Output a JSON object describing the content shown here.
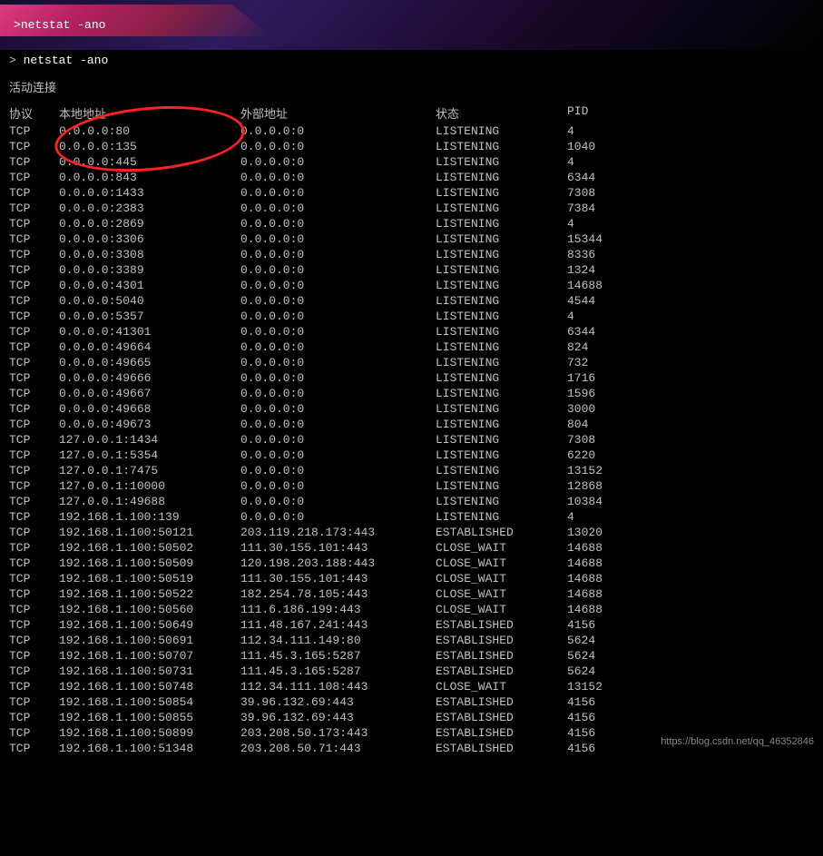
{
  "topbar": {
    "text": "netstat -ano"
  },
  "section_title": "活动连接",
  "headers": {
    "proto": "协议",
    "local": "本地地址",
    "foreign": "外部地址",
    "state": "状态",
    "pid": "PID"
  },
  "rows": [
    {
      "proto": "TCP",
      "local": "0.0.0.0:80",
      "foreign": "0.0.0.0:0",
      "state": "LISTENING",
      "pid": "4"
    },
    {
      "proto": "TCP",
      "local": "0.0.0.0:135",
      "foreign": "0.0.0.0:0",
      "state": "LISTENING",
      "pid": "1040"
    },
    {
      "proto": "TCP",
      "local": "0.0.0.0:445",
      "foreign": "0.0.0.0:0",
      "state": "LISTENING",
      "pid": "4"
    },
    {
      "proto": "TCP",
      "local": "0.0.0.0:843",
      "foreign": "0.0.0.0:0",
      "state": "LISTENING",
      "pid": "6344"
    },
    {
      "proto": "TCP",
      "local": "0.0.0.0:1433",
      "foreign": "0.0.0.0:0",
      "state": "LISTENING",
      "pid": "7308"
    },
    {
      "proto": "TCP",
      "local": "0.0.0.0:2383",
      "foreign": "0.0.0.0:0",
      "state": "LISTENING",
      "pid": "7384"
    },
    {
      "proto": "TCP",
      "local": "0.0.0.0:2869",
      "foreign": "0.0.0.0:0",
      "state": "LISTENING",
      "pid": "4"
    },
    {
      "proto": "TCP",
      "local": "0.0.0.0:3306",
      "foreign": "0.0.0.0:0",
      "state": "LISTENING",
      "pid": "15344"
    },
    {
      "proto": "TCP",
      "local": "0.0.0.0:3308",
      "foreign": "0.0.0.0:0",
      "state": "LISTENING",
      "pid": "8336"
    },
    {
      "proto": "TCP",
      "local": "0.0.0.0:3389",
      "foreign": "0.0.0.0:0",
      "state": "LISTENING",
      "pid": "1324"
    },
    {
      "proto": "TCP",
      "local": "0.0.0.0:4301",
      "foreign": "0.0.0.0:0",
      "state": "LISTENING",
      "pid": "14688"
    },
    {
      "proto": "TCP",
      "local": "0.0.0.0:5040",
      "foreign": "0.0.0.0:0",
      "state": "LISTENING",
      "pid": "4544"
    },
    {
      "proto": "TCP",
      "local": "0.0.0.0:5357",
      "foreign": "0.0.0.0:0",
      "state": "LISTENING",
      "pid": "4"
    },
    {
      "proto": "TCP",
      "local": "0.0.0.0:41301",
      "foreign": "0.0.0.0:0",
      "state": "LISTENING",
      "pid": "6344"
    },
    {
      "proto": "TCP",
      "local": "0.0.0.0:49664",
      "foreign": "0.0.0.0:0",
      "state": "LISTENING",
      "pid": "824"
    },
    {
      "proto": "TCP",
      "local": "0.0.0.0:49665",
      "foreign": "0.0.0.0:0",
      "state": "LISTENING",
      "pid": "732"
    },
    {
      "proto": "TCP",
      "local": "0.0.0.0:49666",
      "foreign": "0.0.0.0:0",
      "state": "LISTENING",
      "pid": "1716"
    },
    {
      "proto": "TCP",
      "local": "0.0.0.0:49667",
      "foreign": "0.0.0.0:0",
      "state": "LISTENING",
      "pid": "1596"
    },
    {
      "proto": "TCP",
      "local": "0.0.0.0:49668",
      "foreign": "0.0.0.0:0",
      "state": "LISTENING",
      "pid": "3000"
    },
    {
      "proto": "TCP",
      "local": "0.0.0.0:49673",
      "foreign": "0.0.0.0:0",
      "state": "LISTENING",
      "pid": "804"
    },
    {
      "proto": "TCP",
      "local": "127.0.0.1:1434",
      "foreign": "0.0.0.0:0",
      "state": "LISTENING",
      "pid": "7308"
    },
    {
      "proto": "TCP",
      "local": "127.0.0.1:5354",
      "foreign": "0.0.0.0:0",
      "state": "LISTENING",
      "pid": "6220"
    },
    {
      "proto": "TCP",
      "local": "127.0.0.1:7475",
      "foreign": "0.0.0.0:0",
      "state": "LISTENING",
      "pid": "13152"
    },
    {
      "proto": "TCP",
      "local": "127.0.0.1:10000",
      "foreign": "0.0.0.0:0",
      "state": "LISTENING",
      "pid": "12868"
    },
    {
      "proto": "TCP",
      "local": "127.0.0.1:49688",
      "foreign": "0.0.0.0:0",
      "state": "LISTENING",
      "pid": "10384"
    },
    {
      "proto": "TCP",
      "local": "192.168.1.100:139",
      "foreign": "0.0.0.0:0",
      "state": "LISTENING",
      "pid": "4"
    },
    {
      "proto": "TCP",
      "local": "192.168.1.100:50121",
      "foreign": "203.119.218.173:443",
      "state": "ESTABLISHED",
      "pid": "13020"
    },
    {
      "proto": "TCP",
      "local": "192.168.1.100:50502",
      "foreign": "111.30.155.101:443",
      "state": "CLOSE_WAIT",
      "pid": "14688"
    },
    {
      "proto": "TCP",
      "local": "192.168.1.100:50509",
      "foreign": "120.198.203.188:443",
      "state": "CLOSE_WAIT",
      "pid": "14688"
    },
    {
      "proto": "TCP",
      "local": "192.168.1.100:50519",
      "foreign": "111.30.155.101:443",
      "state": "CLOSE_WAIT",
      "pid": "14688"
    },
    {
      "proto": "TCP",
      "local": "192.168.1.100:50522",
      "foreign": "182.254.78.105:443",
      "state": "CLOSE_WAIT",
      "pid": "14688"
    },
    {
      "proto": "TCP",
      "local": "192.168.1.100:50560",
      "foreign": "111.6.186.199:443",
      "state": "CLOSE_WAIT",
      "pid": "14688"
    },
    {
      "proto": "TCP",
      "local": "192.168.1.100:50649",
      "foreign": "111.48.167.241:443",
      "state": "ESTABLISHED",
      "pid": "4156"
    },
    {
      "proto": "TCP",
      "local": "192.168.1.100:50691",
      "foreign": "112.34.111.149:80",
      "state": "ESTABLISHED",
      "pid": "5624"
    },
    {
      "proto": "TCP",
      "local": "192.168.1.100:50707",
      "foreign": "111.45.3.165:5287",
      "state": "ESTABLISHED",
      "pid": "5624"
    },
    {
      "proto": "TCP",
      "local": "192.168.1.100:50731",
      "foreign": "111.45.3.165:5287",
      "state": "ESTABLISHED",
      "pid": "5624"
    },
    {
      "proto": "TCP",
      "local": "192.168.1.100:50748",
      "foreign": "112.34.111.108:443",
      "state": "CLOSE_WAIT",
      "pid": "13152"
    },
    {
      "proto": "TCP",
      "local": "192.168.1.100:50854",
      "foreign": "39.96.132.69:443",
      "state": "ESTABLISHED",
      "pid": "4156"
    },
    {
      "proto": "TCP",
      "local": "192.168.1.100:50855",
      "foreign": "39.96.132.69:443",
      "state": "ESTABLISHED",
      "pid": "4156"
    },
    {
      "proto": "TCP",
      "local": "192.168.1.100:50899",
      "foreign": "203.208.50.173:443",
      "state": "ESTABLISHED",
      "pid": "4156"
    },
    {
      "proto": "TCP",
      "local": "192.168.1.100:51348",
      "foreign": "203.208.50.71:443",
      "state": "ESTABLISHED",
      "pid": "4156"
    }
  ],
  "watermark": "https://blog.csdn.net/qq_46352846"
}
